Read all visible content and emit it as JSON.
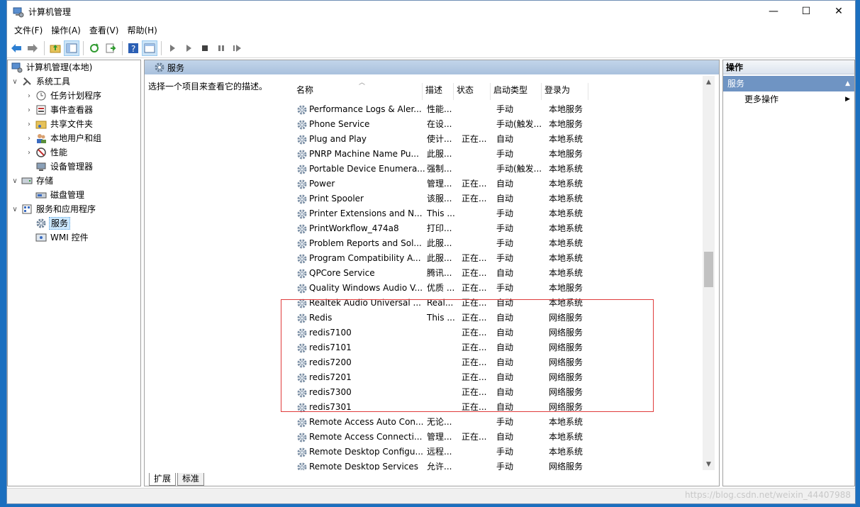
{
  "window": {
    "title": "计算机管理",
    "minimize": "—",
    "maximize": "☐",
    "close": "✕"
  },
  "menu": [
    "文件(F)",
    "操作(A)",
    "查看(V)",
    "帮助(H)"
  ],
  "tree": {
    "root": "计算机管理(本地)",
    "system_tools": "系统工具",
    "task_scheduler": "任务计划程序",
    "event_viewer": "事件查看器",
    "shared_folders": "共享文件夹",
    "local_users": "本地用户和组",
    "performance": "性能",
    "device_manager": "设备管理器",
    "storage": "存储",
    "disk_management": "磁盘管理",
    "services_apps": "服务和应用程序",
    "services": "服务",
    "wmi": "WMI 控件"
  },
  "center": {
    "header": "服务",
    "description_hint": "选择一个项目来查看它的描述。",
    "columns": {
      "name": "名称",
      "desc": "描述",
      "status": "状态",
      "startup": "启动类型",
      "logon": "登录为"
    },
    "tabs": [
      "扩展",
      "标准"
    ]
  },
  "services": [
    {
      "name": "Performance Logs & Aler...",
      "desc": "性能...",
      "status": "",
      "startup": "手动",
      "logon": "本地服务"
    },
    {
      "name": "Phone Service",
      "desc": "在设...",
      "status": "",
      "startup": "手动(触发...",
      "logon": "本地服务"
    },
    {
      "name": "Plug and Play",
      "desc": "使计...",
      "status": "正在...",
      "startup": "自动",
      "logon": "本地系统"
    },
    {
      "name": "PNRP Machine Name Pu...",
      "desc": "此服...",
      "status": "",
      "startup": "手动",
      "logon": "本地服务"
    },
    {
      "name": "Portable Device Enumera...",
      "desc": "强制...",
      "status": "",
      "startup": "手动(触发...",
      "logon": "本地系统"
    },
    {
      "name": "Power",
      "desc": "管理...",
      "status": "正在...",
      "startup": "自动",
      "logon": "本地系统"
    },
    {
      "name": "Print Spooler",
      "desc": "该服...",
      "status": "正在...",
      "startup": "自动",
      "logon": "本地系统"
    },
    {
      "name": "Printer Extensions and N...",
      "desc": "This ...",
      "status": "",
      "startup": "手动",
      "logon": "本地系统"
    },
    {
      "name": "PrintWorkflow_474a8",
      "desc": "打印...",
      "status": "",
      "startup": "手动",
      "logon": "本地系统"
    },
    {
      "name": "Problem Reports and Sol...",
      "desc": "此服...",
      "status": "",
      "startup": "手动",
      "logon": "本地系统"
    },
    {
      "name": "Program Compatibility A...",
      "desc": "此服...",
      "status": "正在...",
      "startup": "手动",
      "logon": "本地系统"
    },
    {
      "name": "QPCore Service",
      "desc": "腾讯...",
      "status": "正在...",
      "startup": "自动",
      "logon": "本地系统"
    },
    {
      "name": "Quality Windows Audio V...",
      "desc": "优质 ...",
      "status": "正在...",
      "startup": "手动",
      "logon": "本地服务"
    },
    {
      "name": "Realtek Audio Universal ...",
      "desc": "Real...",
      "status": "正在...",
      "startup": "自动",
      "logon": "本地系统"
    },
    {
      "name": "Redis",
      "desc": "This ...",
      "status": "正在...",
      "startup": "自动",
      "logon": "网络服务"
    },
    {
      "name": "redis7100",
      "desc": "",
      "status": "正在...",
      "startup": "自动",
      "logon": "网络服务"
    },
    {
      "name": "redis7101",
      "desc": "",
      "status": "正在...",
      "startup": "自动",
      "logon": "网络服务"
    },
    {
      "name": "redis7200",
      "desc": "",
      "status": "正在...",
      "startup": "自动",
      "logon": "网络服务"
    },
    {
      "name": "redis7201",
      "desc": "",
      "status": "正在...",
      "startup": "自动",
      "logon": "网络服务"
    },
    {
      "name": "redis7300",
      "desc": "",
      "status": "正在...",
      "startup": "自动",
      "logon": "网络服务"
    },
    {
      "name": "redis7301",
      "desc": "",
      "status": "正在...",
      "startup": "自动",
      "logon": "网络服务"
    },
    {
      "name": "Remote Access Auto Con...",
      "desc": "无论...",
      "status": "",
      "startup": "手动",
      "logon": "本地系统"
    },
    {
      "name": "Remote Access Connecti...",
      "desc": "管理...",
      "status": "正在...",
      "startup": "自动",
      "logon": "本地系统"
    },
    {
      "name": "Remote Desktop Configu...",
      "desc": "远程...",
      "status": "",
      "startup": "手动",
      "logon": "本地系统"
    },
    {
      "name": "Remote Desktop Services",
      "desc": "允许...",
      "status": "",
      "startup": "手动",
      "logon": "网络服务"
    }
  ],
  "actions": {
    "title": "操作",
    "section": "服务",
    "more": "更多操作"
  },
  "watermark": "https://blog.csdn.net/weixin_44407988",
  "colors": {
    "accent": "#6f94c3",
    "highlight_box": "#e03c3c",
    "desktop": "#1b6fbf"
  }
}
